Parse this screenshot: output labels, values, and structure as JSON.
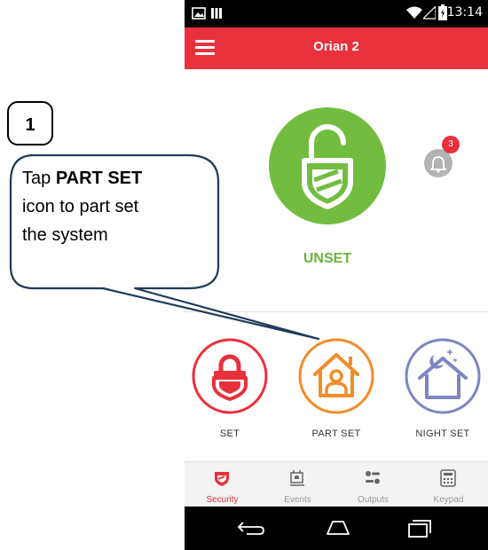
{
  "annotation": {
    "step_number": "1",
    "callout_prefix": "Tap ",
    "callout_bold": "PART SET",
    "callout_line2": "icon to part set",
    "callout_line3": "the system"
  },
  "status_bar": {
    "time": "13:14",
    "icons": [
      "image-icon",
      "bars-icon",
      "wifi-icon",
      "signal-icon",
      "battery-icon"
    ]
  },
  "app_bar": {
    "title": "Orian 2",
    "menu_icon": "hamburger-menu-icon"
  },
  "main": {
    "system_state": "UNSET",
    "state_icon": "unlocked-shield-icon",
    "state_color": "#72bd40",
    "notification_count": "3"
  },
  "modes": [
    {
      "label": "SET",
      "icon": "lock-shield-icon",
      "color": "#e8313d"
    },
    {
      "label": "PART SET",
      "icon": "house-person-icon",
      "color": "#f28c28"
    },
    {
      "label": "NIGHT SET",
      "icon": "house-moon-icon",
      "color": "#7b86c2"
    }
  ],
  "bottom_nav": [
    {
      "label": "Security",
      "icon": "shield-icon",
      "active": true
    },
    {
      "label": "Events",
      "icon": "events-icon",
      "active": false
    },
    {
      "label": "Outputs",
      "icon": "toggles-icon",
      "active": false
    },
    {
      "label": "Keypad",
      "icon": "keypad-icon",
      "active": false
    }
  ],
  "colors": {
    "accent_red": "#e8313d",
    "unset_green": "#72bd40",
    "partset_orange": "#f28c28",
    "nightset_purple": "#7b86c2"
  }
}
